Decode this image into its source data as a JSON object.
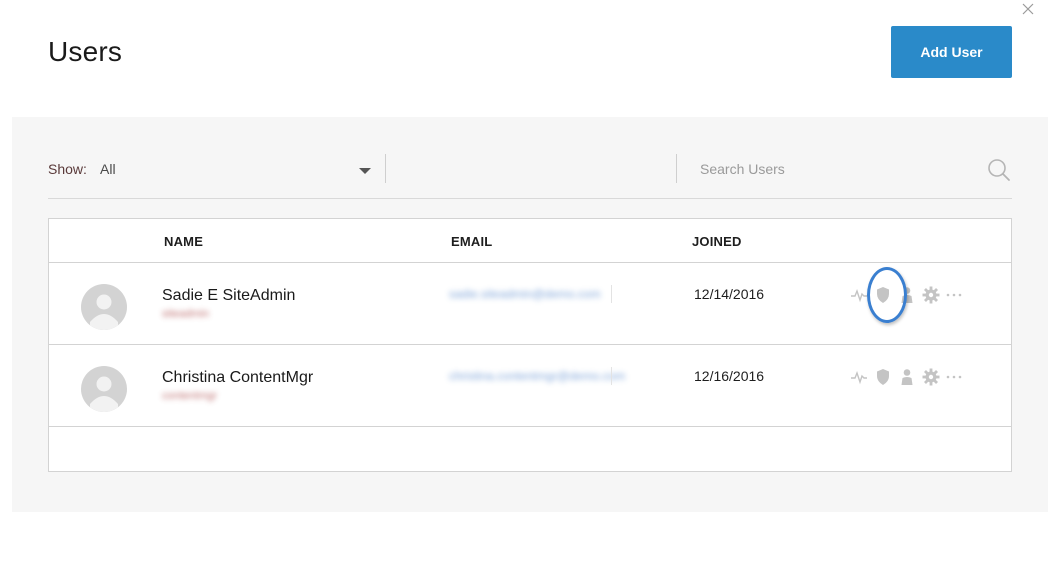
{
  "page": {
    "title": "Users",
    "add_user_label": "Add User"
  },
  "filter": {
    "show_label": "Show:",
    "show_value": "All",
    "search_placeholder": "Search Users"
  },
  "table": {
    "headers": {
      "name": "NAME",
      "email": "EMAIL",
      "joined": "JOINED"
    },
    "rows": [
      {
        "name": "Sadie E SiteAdmin",
        "subtitle": "siteadmin",
        "email": "sadie.siteadmin@demo.com",
        "joined": "12/14/2016",
        "highlighted_action": "shield"
      },
      {
        "name": "Christina ContentMgr",
        "subtitle": "contentmgr",
        "email": "christina.contentmgr@demo.com",
        "joined": "12/16/2016"
      }
    ]
  },
  "row_actions": [
    "activity-icon",
    "shield-icon",
    "person-icon",
    "gear-icon",
    "more-icon"
  ],
  "colors": {
    "accent": "#2a8ac9",
    "highlight_ring": "#3a7fd0",
    "panel_bg": "#f6f6f6",
    "icon_gray": "#c4c4c4"
  }
}
